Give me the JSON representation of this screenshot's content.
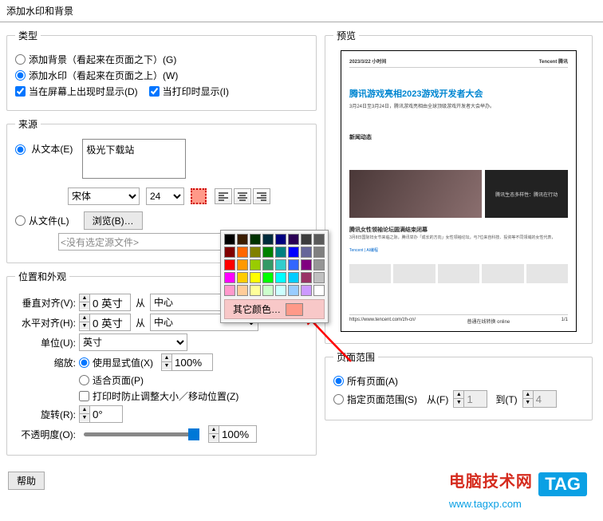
{
  "title": "添加水印和背景",
  "type_group": {
    "legend": "类型",
    "add_bg": "添加背景（看起来在页面之下）(G)",
    "add_wm": "添加水印（看起来在页面之上）(W)",
    "show_screen": "当在屏幕上出现时显示(D)",
    "show_print": "当打印时显示(I)"
  },
  "source_group": {
    "legend": "来源",
    "from_text": "从文本(E)",
    "text_value": "极光下载站",
    "font": "宋体",
    "size": "24",
    "from_file": "从文件(L)",
    "browse": "浏览(B)…",
    "no_source": "<没有选定源文件>"
  },
  "pos_group": {
    "legend": "位置和外观",
    "valign": "垂直对齐(V):",
    "halign": "水平对齐(H):",
    "offset": "0 英寸",
    "from": "从",
    "center": "中心",
    "unit": "单位(U):",
    "inch": "英寸",
    "scale": "缩放:",
    "explicit": "使用显式值(X)",
    "scale_val": "100%",
    "fit_page": "适合页面(P)",
    "lock_print": "打印时防止调整大小／移动位置(Z)",
    "rotate": "旋转(R):",
    "rotate_val": "0°",
    "opacity": "不透明度(O):",
    "opacity_val": "100%"
  },
  "color_popup": {
    "other": "其它颜色…"
  },
  "preview_group": {
    "legend": "预览"
  },
  "preview_page": {
    "date": "2023/3/22 小时间",
    "brand": "Tencent 腾讯",
    "headline": "腾讯游戏亮相2023游戏开发者大会",
    "subline": "3月24日至3月24日，腾讯游戏亮相由全球顶级游戏开发者大会举办。",
    "section": "新闻动态",
    "caption": "腾讯女性领袖论坛圆满结束闭幕",
    "body": "3月8日国际妇女节来临之际，腾讯举办「成长的方向」女性领袖论坛，与7位来自科技、投资等不同领域的女性代表，",
    "side1": "腾讯生态多样性：腾讯在行动",
    "side2": "Tencent | AI编程",
    "footer_left": "https://www.tencent.com/zh-cn/",
    "footer_mid": "普通在线转换 online",
    "footer_right": "1/1"
  },
  "range_group": {
    "legend": "页面范围",
    "all": "所有页面(A)",
    "range": "指定页面范围(S)",
    "from": "从(F)",
    "from_val": "1",
    "to": "到(T)",
    "to_val": "4"
  },
  "help": "帮助",
  "logo": {
    "line1": "电脑技术网",
    "tag": "TAG",
    "line2": "www.tagxp.com"
  },
  "colors": {
    "row1": [
      "#000000",
      "#3b1d00",
      "#003200",
      "#002b3c",
      "#000080",
      "#2b0055",
      "#3c3c3c",
      "#5a5a5a"
    ],
    "row2": [
      "#800000",
      "#ff6600",
      "#808000",
      "#008000",
      "#008080",
      "#0000ff",
      "#666699",
      "#808080"
    ],
    "row3": [
      "#ff0000",
      "#ff9900",
      "#99cc00",
      "#339966",
      "#33cccc",
      "#3366ff",
      "#800080",
      "#969696"
    ],
    "row4": [
      "#ff00ff",
      "#ffcc00",
      "#ffff00",
      "#00ff00",
      "#00ffff",
      "#00ccff",
      "#993366",
      "#c0c0c0"
    ],
    "row5": [
      "#ff99cc",
      "#ffcc99",
      "#ffff99",
      "#ccffcc",
      "#ccffff",
      "#99ccff",
      "#cc99ff",
      "#ffffff"
    ]
  }
}
